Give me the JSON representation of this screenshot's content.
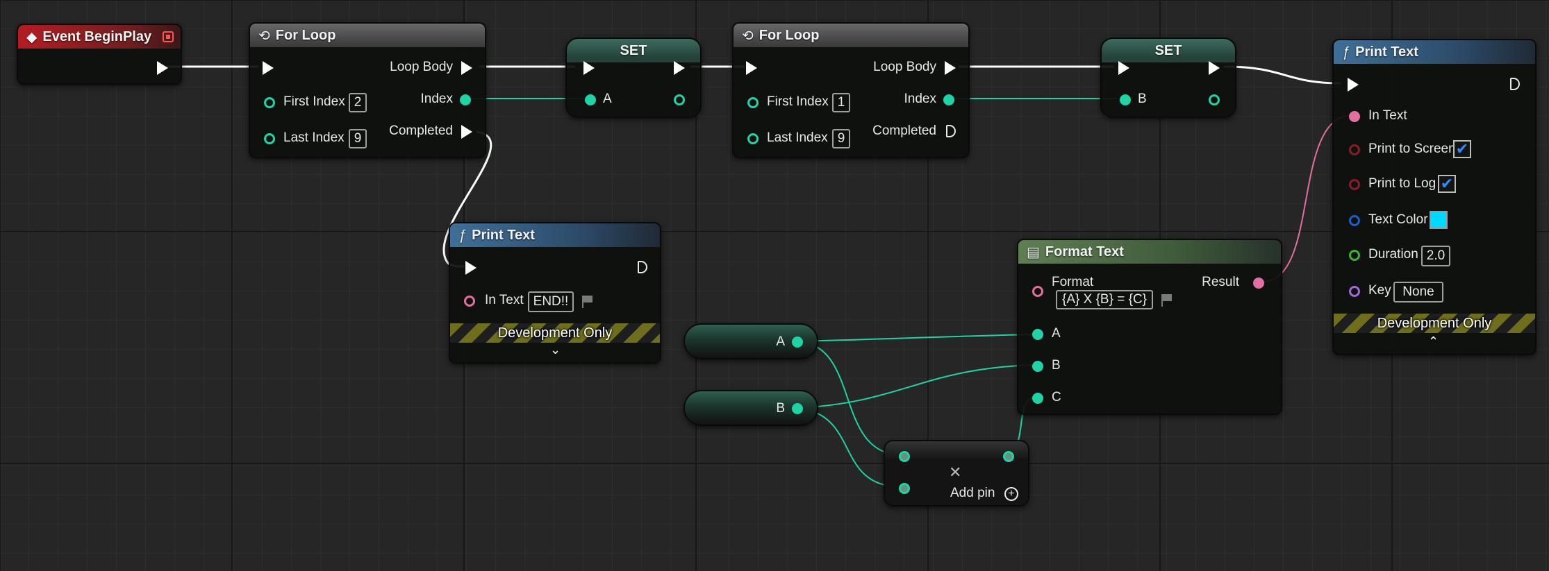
{
  "colors": {
    "exec_wire": "#ffffff",
    "int_wire": "#1fd3a5",
    "text_wire": "#e36fa0"
  },
  "nodes": {
    "event_begin_play": {
      "title": "Event BeginPlay",
      "icon": "event-diamond-icon"
    },
    "for_loop_1": {
      "title": "For Loop",
      "icon": "loop-icon",
      "loop_body": "Loop Body",
      "index": "Index",
      "completed": "Completed",
      "first_index_label": "First Index",
      "first_index_value": "2",
      "last_index_label": "Last Index",
      "last_index_value": "9"
    },
    "set_1": {
      "title": "SET",
      "var": "A"
    },
    "for_loop_2": {
      "title": "For Loop",
      "icon": "loop-icon",
      "loop_body": "Loop Body",
      "index": "Index",
      "completed": "Completed",
      "first_index_label": "First Index",
      "first_index_value": "1",
      "last_index_label": "Last Index",
      "last_index_value": "9"
    },
    "set_2": {
      "title": "SET",
      "var": "B"
    },
    "print_text_main": {
      "title": "Print Text",
      "icon": "function-icon",
      "in_text": "In Text",
      "print_to_screen": "Print to Screen",
      "print_to_log": "Print to Log",
      "text_color": "Text Color",
      "text_color_value": "#00d9ff",
      "duration": "Duration",
      "duration_value": "2.0",
      "key": "Key",
      "key_value": "None",
      "dev_only": "Development Only"
    },
    "print_text_end": {
      "title": "Print Text",
      "icon": "function-icon",
      "in_text": "In Text",
      "in_text_value": "END!!",
      "dev_only": "Development Only"
    },
    "format_text": {
      "title": "Format Text",
      "icon": "format-text-icon",
      "format": "Format",
      "format_value": "{A} X {B} = {C}",
      "result": "Result",
      "pin_a": "A",
      "pin_b": "B",
      "pin_c": "C"
    },
    "get_a": {
      "label": "A"
    },
    "get_b": {
      "label": "B"
    },
    "multiply": {
      "symbol": "✕",
      "add_pin": "Add pin"
    }
  }
}
